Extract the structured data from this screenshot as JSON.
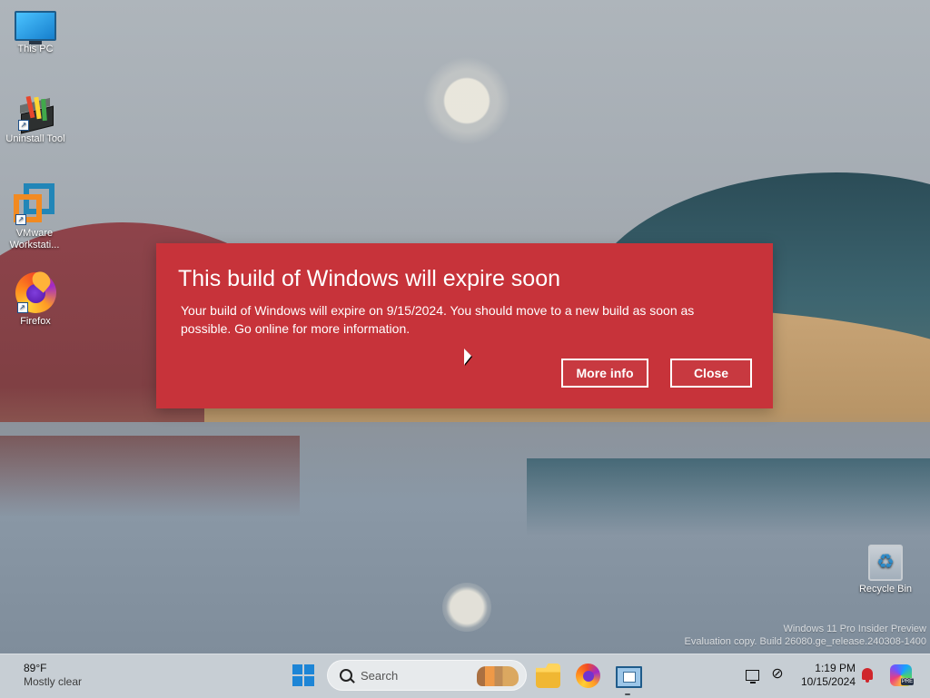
{
  "desktop": {
    "icons": [
      {
        "label": "This PC",
        "icon": "this-pc-icon"
      },
      {
        "label": "Uninstall Tool",
        "icon": "uninstall-tool-icon"
      },
      {
        "label": "VMware Workstati...",
        "icon": "vmware-workstation-icon"
      },
      {
        "label": "Firefox",
        "icon": "firefox-icon"
      },
      {
        "label": "Recycle Bin",
        "icon": "recycle-bin-icon"
      }
    ],
    "watermark": {
      "line1": "Windows 11 Pro Insider Preview",
      "line2": "Evaluation copy. Build 26080.ge_release.240308-1400"
    }
  },
  "dialog": {
    "title": "This build of Windows will expire soon",
    "message": "Your build of Windows will expire on 9/15/2024. You should move to a new build as soon as possible. Go online for more information.",
    "buttons": {
      "more_info": "More info",
      "close": "Close"
    },
    "background_color": "#c7333a"
  },
  "taskbar": {
    "weather": {
      "temperature": "89°F",
      "condition": "Mostly clear"
    },
    "search": {
      "placeholder": "Search"
    },
    "icons": [
      "start-icon",
      "file-explorer-icon",
      "firefox-icon",
      "app-window-icon"
    ],
    "tray": {
      "time": "1:19 PM",
      "date": "10/15/2024",
      "notification_color": "#d0262b",
      "copilot_badge": "PRE"
    }
  }
}
